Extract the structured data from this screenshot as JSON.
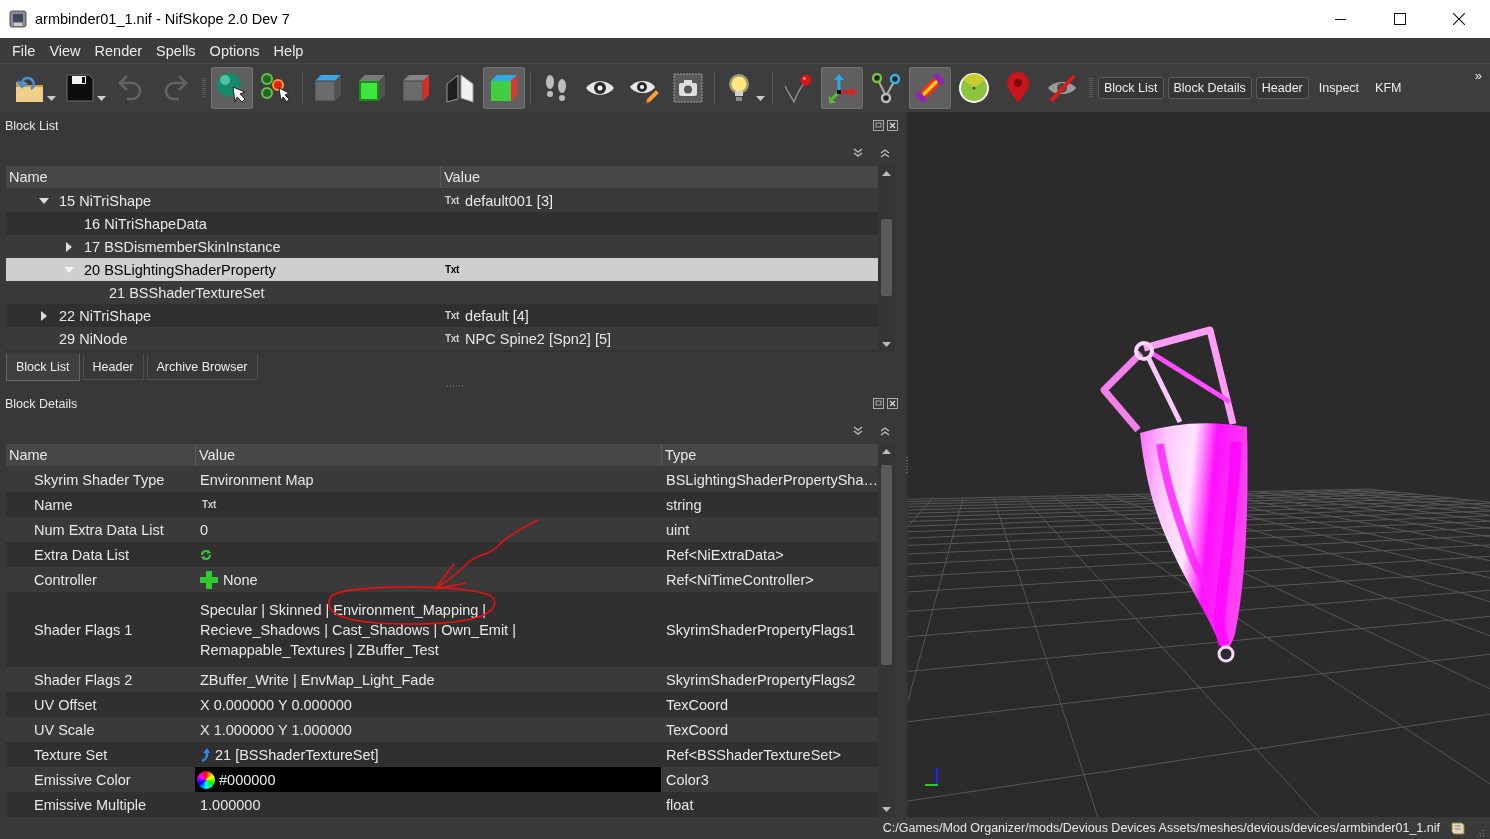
{
  "window": {
    "title": "armbinder01_1.nif - NifSkope 2.0 Dev 7"
  },
  "menu": [
    "File",
    "View",
    "Render",
    "Spells",
    "Options",
    "Help"
  ],
  "toolbar": {
    "tools": [
      {
        "checked": false,
        "disabled": false
      },
      {
        "checked": false,
        "disabled": false
      },
      {
        "checked": false,
        "disabled": true
      },
      {
        "checked": false,
        "disabled": true
      },
      {
        "checked": true,
        "disabled": false
      },
      {
        "checked": false,
        "disabled": false
      },
      {
        "checked": false,
        "disabled": false
      },
      {
        "checked": false,
        "disabled": false
      },
      {
        "checked": false,
        "disabled": false
      },
      {
        "checked": false,
        "disabled": false
      },
      {
        "checked": true,
        "disabled": false
      },
      {
        "checked": false,
        "disabled": false
      },
      {
        "checked": false,
        "disabled": false
      },
      {
        "checked": false,
        "disabled": false
      },
      {
        "checked": false,
        "disabled": false
      },
      {
        "checked": false,
        "disabled": false
      },
      {
        "checked": false,
        "disabled": false
      },
      {
        "checked": true,
        "disabled": false
      },
      {
        "checked": false,
        "disabled": false
      },
      {
        "checked": true,
        "disabled": false
      },
      {
        "checked": false,
        "disabled": false
      },
      {
        "checked": false,
        "disabled": false
      },
      {
        "checked": false,
        "disabled": false
      }
    ],
    "toggles": [
      {
        "label": "Block List",
        "checked": true
      },
      {
        "label": "Block Details",
        "checked": true
      },
      {
        "label": "Header",
        "checked": true
      },
      {
        "label": "Inspect",
        "checked": false
      },
      {
        "label": "KFM",
        "checked": false
      }
    ],
    "overflow": "»"
  },
  "block_list": {
    "title": "Block List",
    "columns": [
      "Name",
      "Value"
    ],
    "rows": [
      {
        "name": "15 NiTriShape",
        "badge": "Txt",
        "value": "default001 [3]",
        "expanded": true,
        "selected": false,
        "children": [
          {
            "name": "16 NiTriShapeData",
            "selected": false
          },
          {
            "name": "17 BSDismemberSkinInstance",
            "expanded": false,
            "selected": false
          },
          {
            "name": "20 BSLightingShaderProperty",
            "badge": "Txt",
            "expanded": true,
            "selected": true,
            "children": [
              {
                "name": "21 BSShaderTextureSet",
                "selected": false
              }
            ]
          }
        ]
      },
      {
        "name": "22 NiTriShape",
        "badge": "Txt",
        "value": "default [4]",
        "expanded": false,
        "selected": false
      },
      {
        "name": "29 NiNode",
        "badge": "Txt",
        "value": "NPC Spine2 [Spn2] [5]",
        "selected": false
      }
    ],
    "tabs": [
      {
        "label": "Block List",
        "selected": true
      },
      {
        "label": "Header",
        "selected": false
      },
      {
        "label": "Archive Browser",
        "selected": false
      }
    ]
  },
  "block_details": {
    "title": "Block Details",
    "columns": [
      "Name",
      "Value",
      "Type"
    ],
    "rows": [
      {
        "name": "Skyrim Shader Type",
        "kind": "plain",
        "value": "Environment Map",
        "type": "BSLightingShaderPropertySha…"
      },
      {
        "name": "Name",
        "kind": "string",
        "badge": "Txt",
        "type": "string"
      },
      {
        "name": "Num Extra Data List",
        "kind": "plain",
        "value": "0",
        "type": "uint"
      },
      {
        "name": "Extra Data List",
        "kind": "array",
        "type": "Ref<NiExtraData>"
      },
      {
        "name": "Controller",
        "kind": "ref_empty",
        "value": "None",
        "type": "Ref<NiTimeController>"
      },
      {
        "name": "Shader Flags 1",
        "kind": "flags",
        "lines": [
          [
            "Specular | Skinned |",
            "Environment_Mapping |"
          ],
          [
            "Recieve_Shadows | Cast_Shadows | Own_Emit |"
          ],
          [
            "Remappable_Textures | ZBuffer_Test"
          ]
        ],
        "type": "SkyrimShaderPropertyFlags1"
      },
      {
        "name": "Shader Flags 2",
        "kind": "plain",
        "value": "ZBuffer_Write | EnvMap_Light_Fade",
        "type": "SkyrimShaderPropertyFlags2"
      },
      {
        "name": "UV Offset",
        "kind": "plain",
        "value": "X 0.000000 Y 0.000000",
        "type": "TexCoord"
      },
      {
        "name": "UV Scale",
        "kind": "plain",
        "value": "X 1.000000 Y 1.000000",
        "type": "TexCoord"
      },
      {
        "name": "Texture Set",
        "kind": "ref_link",
        "value": "21 [BSShaderTextureSet]",
        "type": "Ref<BSShaderTextureSet>"
      },
      {
        "name": "Emissive Color",
        "kind": "color",
        "value": "#000000",
        "color": "#000000",
        "type": "Color3"
      },
      {
        "name": "Emissive Multiple",
        "kind": "plain",
        "value": "1.000000",
        "type": "float"
      }
    ]
  },
  "status_bar": {
    "path": "C:/Games/Mod Organizer/mods/Devious Devices Assets/meshes/devious/devices/armbinder01_1.nif"
  }
}
